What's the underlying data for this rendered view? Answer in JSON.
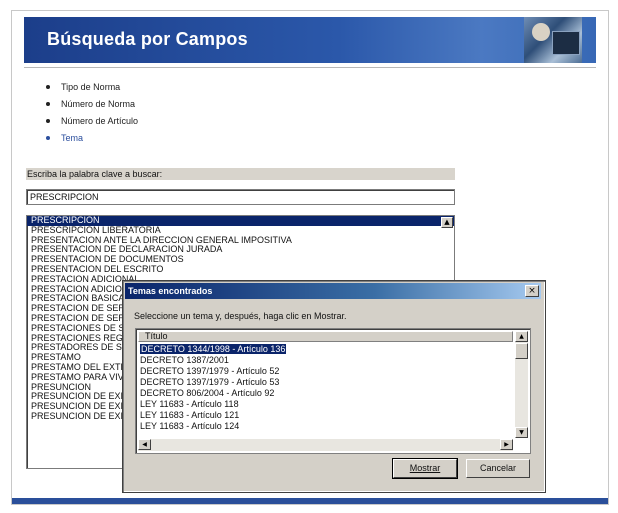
{
  "header": {
    "title": "Búsqueda por Campos"
  },
  "menu": {
    "items": [
      {
        "label": "Tipo de Norma",
        "active": false
      },
      {
        "label": "Número de Norma",
        "active": false
      },
      {
        "label": "Número de Artículo",
        "active": false
      },
      {
        "label": "Tema",
        "active": true
      }
    ]
  },
  "search": {
    "label": "Escriba la palabra clave a buscar:",
    "value": "PRESCRIPCION"
  },
  "terms": [
    "PRESCRIPCION",
    "PRESCRIPCION LIBERATORIA",
    "PRESENTACION ANTE LA DIRECCION GENERAL IMPOSITIVA",
    "PRESENTACION DE DECLARACION JURADA",
    "PRESENTACION DE DOCUMENTOS",
    "PRESENTACION DEL ESCRITO",
    "PRESTACION ADICIONAL",
    "PRESTACION ADICIONAL",
    "PRESTACION BASICA",
    "PRESTACION DE SERVICIOS",
    "PRESTACION DE SERVICIOS",
    "PRESTACIONES DE SALUD",
    "PRESTACIONES REGIMEN",
    "PRESTADORES DE SALUD",
    "PRESTAMO",
    "PRESTAMO DEL EXTERIOR",
    "PRESTAMO PARA VIVIENDA",
    "PRESUNCION",
    "PRESUNCION DE EXISTENCIA",
    "PRESUNCION DE EXISTENCIA",
    "PRESUNCION DE EXISTENCIA"
  ],
  "dialog": {
    "title": "Temas encontrados",
    "close": "×",
    "instruction": "Seleccione un tema y, después, haga clic en Mostrar.",
    "column_header": "Título",
    "rows": [
      "DECRETO 1344/1998 - Artículo 136",
      "DECRETO 1387/2001",
      "DECRETO 1397/1979 - Artículo 52",
      "DECRETO 1397/1979 - Artículo 53",
      "DECRETO 806/2004 - Artículo 92",
      "LEY 11683 - Artículo 118",
      "LEY 11683 - Artículo 121",
      "LEY 11683 - Artículo 124"
    ],
    "selected_row": 0,
    "buttons": {
      "show": "Mostrar",
      "cancel": "Cancelar"
    }
  },
  "colors": {
    "banner": "#1c3e8a",
    "selection": "#0a246a",
    "dialog_bg": "#d4d0c8"
  }
}
